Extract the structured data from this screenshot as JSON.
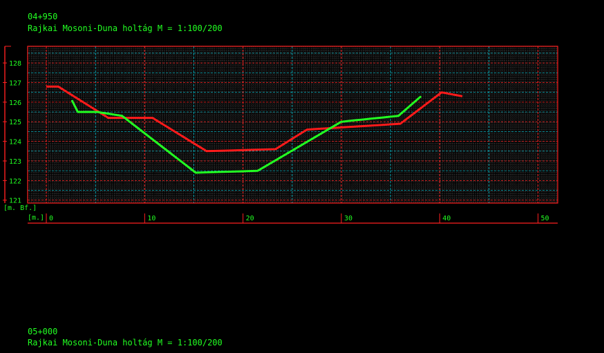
{
  "header": {
    "station": "04+950",
    "title": "Rajkai Mosoni-Duna holtág M = 1:100/200"
  },
  "footer": {
    "station": "05+000",
    "title": "Rajkai Mosoni-Duna holtág M = 1:100/200"
  },
  "colors": {
    "background": "#000000",
    "grid_red": "#ff2020",
    "grid_cyan": "#00c8d8",
    "grid_fine": "#909090",
    "text": "#22ff22",
    "series_red": "#ff1a1a",
    "series_green": "#22ff22"
  },
  "chart_data": {
    "type": "line",
    "title": "",
    "xlabel": "[m.]",
    "ylabel": "[m. Bf.]",
    "xlim": [
      -1.9,
      52
    ],
    "ylim": [
      120.85,
      128.85
    ],
    "x_ticks": [
      0,
      10,
      20,
      30,
      40,
      50
    ],
    "y_ticks": [
      121,
      122,
      123,
      124,
      125,
      126,
      127,
      128
    ],
    "grid": true,
    "legend": "none",
    "series": [
      {
        "color": "#ff1a1a",
        "x": [
          0,
          1.2,
          6.3,
          10.8,
          16.3,
          23.3,
          26.5,
          36,
          40.2,
          42.3
        ],
        "y": [
          126.8,
          126.8,
          125.2,
          125.2,
          123.5,
          123.6,
          124.6,
          124.9,
          126.5,
          126.3
        ]
      },
      {
        "color": "#22ff22",
        "x": [
          2.6,
          3.2,
          5.2,
          7.7,
          15.2,
          21.5,
          30,
          35.8,
          38.1
        ],
        "y": [
          126.1,
          125.5,
          125.5,
          125.3,
          122.4,
          122.5,
          125,
          125.3,
          126.3
        ]
      }
    ]
  }
}
